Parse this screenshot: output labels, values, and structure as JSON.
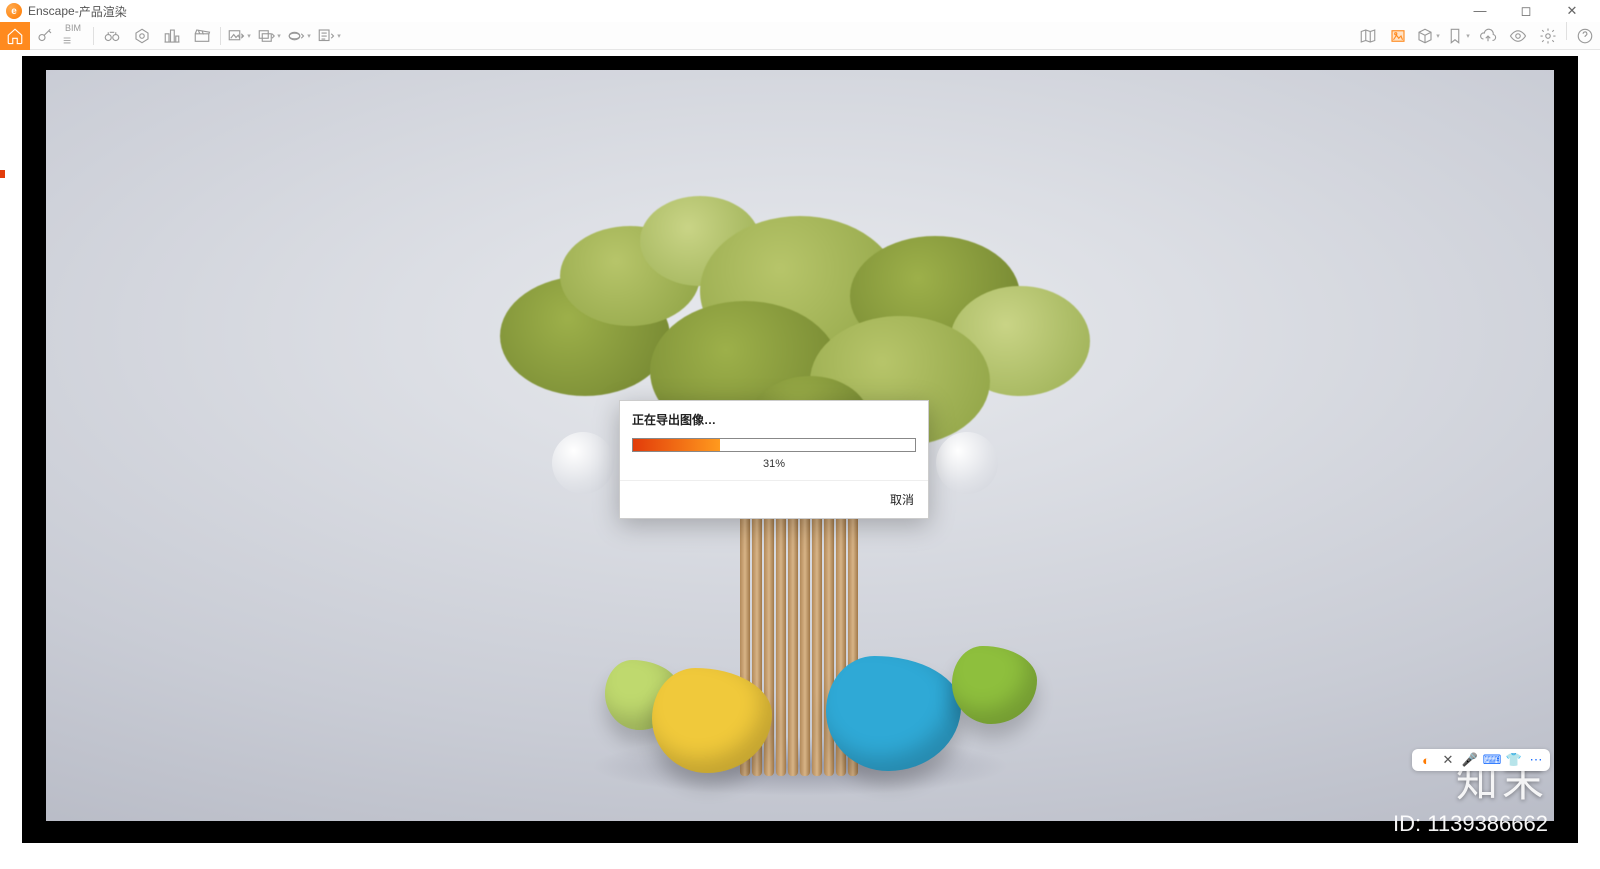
{
  "window": {
    "app_name": "Enscape",
    "title_sep": " - ",
    "doc_title": "产品渲染"
  },
  "toolbar": {
    "home": "home-icon",
    "key": "key-icon",
    "bim_label": "BIM",
    "left_group": [
      "binoculars-icon",
      "view-orbit-icon",
      "cityscape-icon",
      "clapper-icon"
    ],
    "export_group": [
      "export-image-icon",
      "export-batch-icon",
      "export-360-icon",
      "export-exe-icon"
    ],
    "right_group": [
      "map-icon",
      "gallery-icon",
      "asset-box-icon",
      "bookmark-icon",
      "upload-cloud-icon",
      "eye-icon",
      "gear-icon",
      "help-icon"
    ]
  },
  "dialog": {
    "title": "正在导出图像…",
    "percent_value": 31,
    "percent_label": "31%",
    "cancel": "取消"
  },
  "overlay": {
    "brand": "知末",
    "id_prefix": "ID: ",
    "id_value": "1139386662"
  },
  "colors": {
    "accent": "#ff8a1e",
    "progress_start": "#e23c0a",
    "progress_end": "#ff9a1e"
  }
}
